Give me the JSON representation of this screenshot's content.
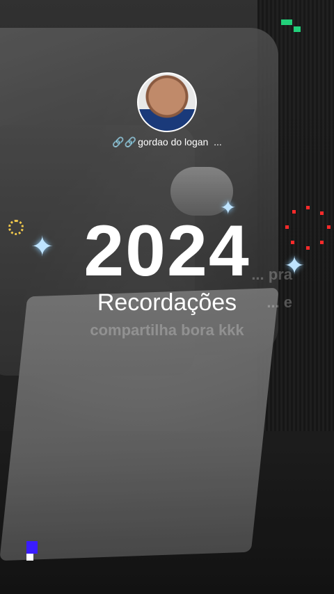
{
  "profile": {
    "link_icons": "🔗🔗",
    "name": "gordao do logan",
    "ellipsis": "..."
  },
  "title": {
    "year": "2024",
    "subtitle": "Recordações",
    "overlay_text_line1": "... pra",
    "overlay_text_line2": "... e",
    "overlay_text_line3": "compartilha bora kkk"
  },
  "colors": {
    "accent_green": "#22d07a",
    "accent_blue": "#3a1cff",
    "sparkle": "#bfe4ff",
    "sun": "#f2c94c",
    "red_dots": "#ff2a2a"
  },
  "icons": [
    "avatar",
    "link-icon",
    "sparkle-icon",
    "sun-icon",
    "pixel-decoration"
  ]
}
